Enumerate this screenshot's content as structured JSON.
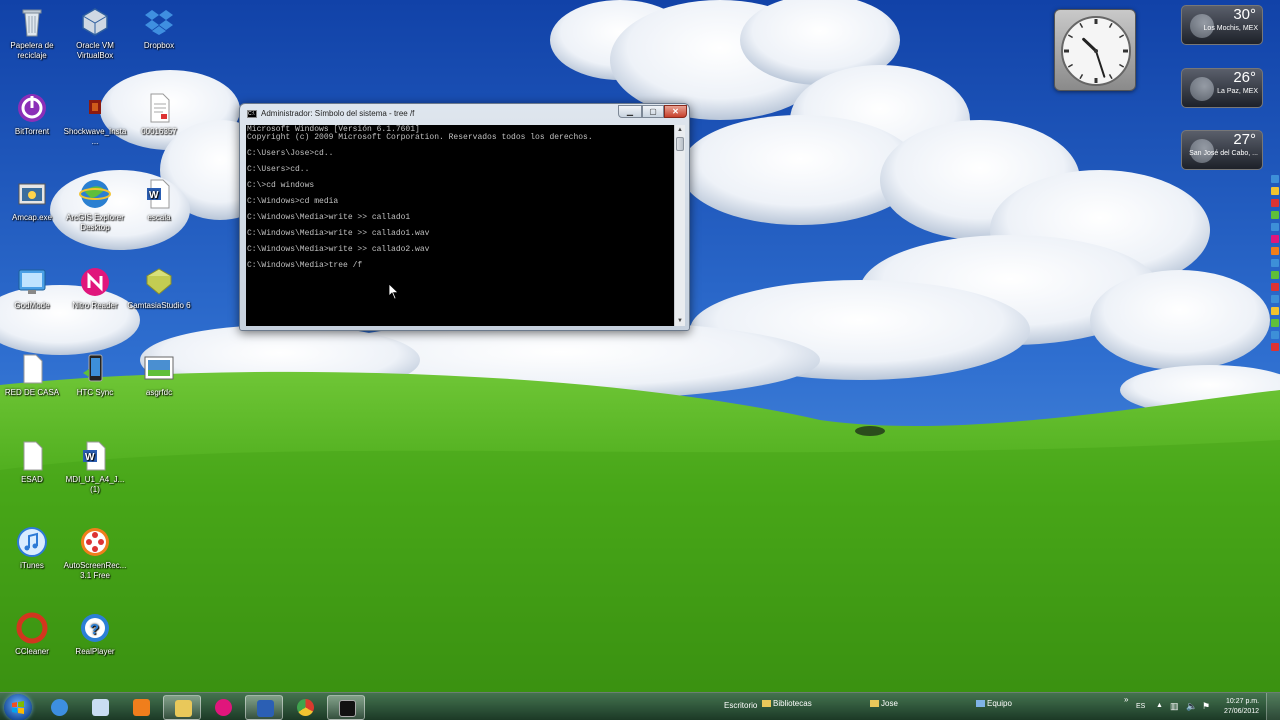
{
  "desktop": {
    "icons": [
      {
        "label": "Papelera de reciclaje",
        "icon": "recycle-bin-icon"
      },
      {
        "label": "Oracle VM VirtualBox",
        "icon": "virtualbox-icon"
      },
      {
        "label": "Dropbox",
        "icon": "dropbox-icon"
      },
      {
        "label": "BitTorrent",
        "icon": "bittorrent-icon"
      },
      {
        "label": "Shockwave_Insta...",
        "icon": "shockwave-installer-icon"
      },
      {
        "label": "00016357",
        "icon": "document-icon"
      },
      {
        "label": "Amcap.exe",
        "icon": "amcap-icon"
      },
      {
        "label": "ArcGIS Explorer Desktop",
        "icon": "arcgis-globe-icon"
      },
      {
        "label": "escala",
        "icon": "word-document-icon"
      },
      {
        "label": "GodMode",
        "icon": "control-panel-icon"
      },
      {
        "label": "Nitro Reader",
        "icon": "nitro-reader-icon"
      },
      {
        "label": "CamtasiaStudio 6",
        "icon": "folder-zip-icon"
      },
      {
        "label": "RED DE CASA",
        "icon": "network-document-icon"
      },
      {
        "label": "HTC Sync",
        "icon": "htc-sync-icon"
      },
      {
        "label": "asgrfdc",
        "icon": "screenshot-file-icon"
      },
      {
        "label": "ESAD",
        "icon": "blank-document-icon"
      },
      {
        "label": "MDI_U1_A4_J... (1)",
        "icon": "word-document-icon"
      },
      {
        "label": "iTunes",
        "icon": "itunes-icon"
      },
      {
        "label": "AutoScreenRec... 3.1 Free",
        "icon": "autoscreenrecorder-icon"
      },
      {
        "label": "CCleaner",
        "icon": "ccleaner-icon"
      },
      {
        "label": "RealPlayer",
        "icon": "realplayer-icon"
      }
    ]
  },
  "gadgets": {
    "clock": {
      "hour": 10,
      "minute": 27
    },
    "weather": [
      {
        "temp": "30°",
        "city": "Los Mochis, MEX"
      },
      {
        "temp": "26°",
        "city": "La Paz, MEX"
      },
      {
        "temp": "27°",
        "city": "San José del Cabo, ..."
      }
    ]
  },
  "cmd_window": {
    "title": "Administrador: Símbolo del sistema - tree /f",
    "lines": [
      "Microsoft Windows [Versión 6.1.7601]",
      "Copyright (c) 2009 Microsoft Corporation. Reservados todos los derechos.",
      "",
      "C:\\Users\\Jose>cd..",
      "",
      "C:\\Users>cd..",
      "",
      "C:\\>cd windows",
      "",
      "C:\\Windows>cd media",
      "",
      "C:\\Windows\\Media>write >> callado1",
      "",
      "C:\\Windows\\Media>write >> callado1.wav",
      "",
      "C:\\Windows\\Media>write >> callado2.wav",
      "",
      "C:\\Windows\\Media>tree /f"
    ]
  },
  "taskbar": {
    "pinned": [
      {
        "icon": "internet-explorer-icon",
        "active": false
      },
      {
        "icon": "notepad-icon",
        "active": false
      },
      {
        "icon": "media-player-icon",
        "active": false
      },
      {
        "icon": "windows-explorer-icon",
        "active": true
      },
      {
        "icon": "nitro-reader-icon",
        "active": false
      },
      {
        "icon": "word-icon",
        "active": true
      },
      {
        "icon": "chrome-icon",
        "active": false
      },
      {
        "icon": "command-prompt-icon",
        "active": true
      }
    ],
    "toolbar_links": [
      "Escritorio",
      "Bibliotecas",
      "Jose",
      "Equipo"
    ],
    "language": "ES",
    "time": "10:27 p.m.",
    "date": "27/06/2012"
  }
}
